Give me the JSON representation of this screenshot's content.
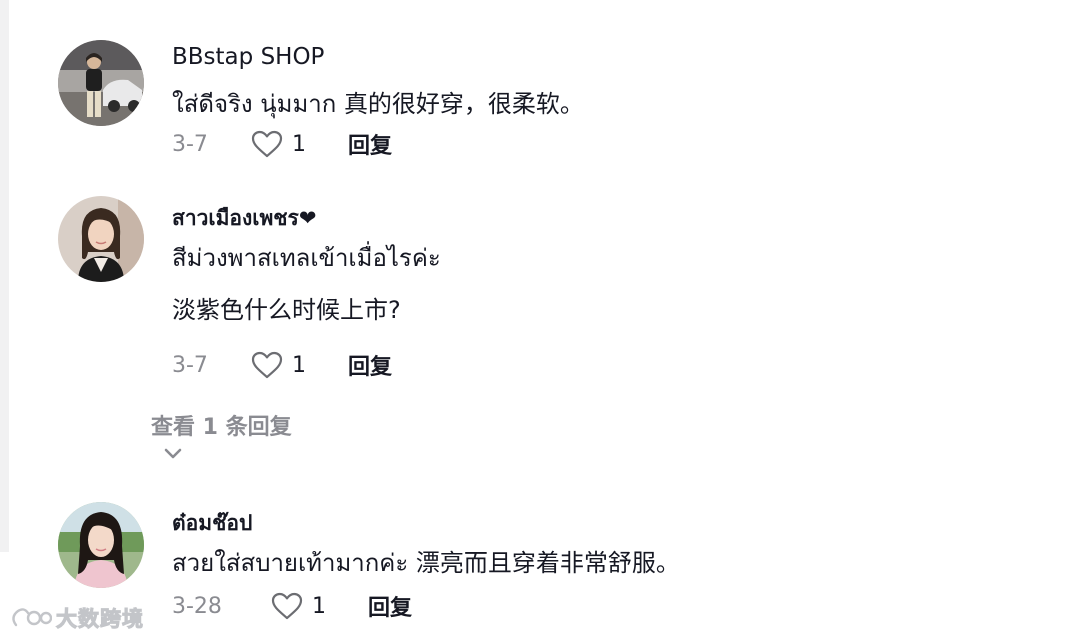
{
  "comments": [
    {
      "username": "BBstap SHOP",
      "lines": [
        "ใส่ดีจริง นุ่มมาก 真的很好穿，很柔软。"
      ],
      "date": "3-7",
      "likes": "1",
      "reply_label": "回复",
      "avatar": "avatar-man-with-car-photo"
    },
    {
      "username": "สาวเมืองเพชร❤",
      "lines": [
        "สีม่วงพาสเทลเข้าเมื่อไรค่ะ",
        "淡紫色什么时候上市?"
      ],
      "date": "3-7",
      "likes": "1",
      "reply_label": "回复",
      "avatar": "avatar-woman-photo",
      "view_replies": "查看 1 条回复"
    },
    {
      "username": "ต๋อมช๊อป",
      "lines": [
        "สวยใส่สบายเท้ามากค่ะ 漂亮而且穿着非常舒服。"
      ],
      "date": "3-28",
      "likes": "1",
      "reply_label": "回复",
      "avatar": "avatar-woman-outdoor-photo"
    }
  ],
  "icons": {
    "like": "heart-outline-icon",
    "expand": "chevron-down-icon"
  },
  "watermark": {
    "text": "大数跨境"
  },
  "colors": {
    "primary_text": "#161823",
    "secondary_text": "#8a8b91"
  }
}
